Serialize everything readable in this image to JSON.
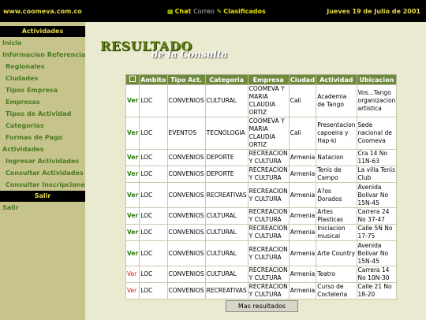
{
  "topbar": {
    "site": "www.coomeva.com.co",
    "chat": "Chat",
    "correo": "Correo",
    "clasificados": "Clasificados",
    "date": "Jueves 19 de Julio de 2001"
  },
  "sidebar": {
    "actividades_header": "Actividades",
    "items": [
      {
        "label": "Inicio",
        "level": 0
      },
      {
        "label": "Informacion Referencial",
        "level": 0
      },
      {
        "label": "Regionales",
        "level": 1
      },
      {
        "label": "Ciudades",
        "level": 1
      },
      {
        "label": "Tipos Empresa",
        "level": 1
      },
      {
        "label": "Empresas",
        "level": 1
      },
      {
        "label": "Tipos de Actividad",
        "level": 1
      },
      {
        "label": "Categorias",
        "level": 1
      },
      {
        "label": "Formas de Pago",
        "level": 1
      },
      {
        "label": "Actividades",
        "level": 0
      },
      {
        "label": "Ingresar Actividades",
        "level": 1
      },
      {
        "label": "Consultar Actividades",
        "level": 1
      },
      {
        "label": "Consultar Inscripciones",
        "level": 1
      }
    ],
    "salir_header": "Salir",
    "salir_item": "Salir"
  },
  "main": {
    "title1": "RESULTADO",
    "title2": "de la Consulta",
    "more_button": "Mas resultados"
  },
  "table": {
    "headers": [
      "Ambito",
      "Tipo Act.",
      "Categoria",
      "Empresa",
      "Ciudad",
      "Actividad",
      "Ubicacion"
    ],
    "ver_label": "Ver",
    "rows": [
      {
        "ambito": "LOC",
        "tipo": "CONVENIOS",
        "categoria": "CULTURAL",
        "empresa": "COOMEVA Y MARIA CLAUDIA ORTIZ",
        "ciudad": "Cali",
        "actividad": "Academia de Tango",
        "ubicacion": "Vos...Tango organizacion artistica",
        "red": false
      },
      {
        "ambito": "LOC",
        "tipo": "EVENTOS",
        "categoria": "TECNOLOGIA",
        "empresa": "COOMEVA Y MARIA CLAUDIA ORTIZ",
        "ciudad": "Cali",
        "actividad": "Presentacion capoeira y Hap-ki",
        "ubicacion": "Sede nacional de Coomeva",
        "red": false
      },
      {
        "ambito": "LOC",
        "tipo": "CONVENIOS",
        "categoria": "DEPORTE",
        "empresa": "RECREACION Y CULTURA",
        "ciudad": "Armenia",
        "actividad": "Natacion",
        "ubicacion": "Cra 14 No 11N-63",
        "red": false
      },
      {
        "ambito": "LOC",
        "tipo": "CONVENIOS",
        "categoria": "DEPORTE",
        "empresa": "RECREACION Y CULTURA",
        "ciudad": "Armenia",
        "actividad": "Tenis de Campo",
        "ubicacion": "La villa Tenis Club",
        "red": false
      },
      {
        "ambito": "LOC",
        "tipo": "CONVENIOS",
        "categoria": "RECREATIVAS",
        "empresa": "RECREACION Y CULTURA",
        "ciudad": "Armenia",
        "actividad": "A?os Dorados",
        "ubicacion": "Avenida Bolivar No 15N-45",
        "red": false
      },
      {
        "ambito": "LOC",
        "tipo": "CONVENIOS",
        "categoria": "CULTURAL",
        "empresa": "RECREACION Y CULTURA",
        "ciudad": "Armenia",
        "actividad": "Artes Plasticas",
        "ubicacion": "Carrera 24 No 37-47",
        "red": false
      },
      {
        "ambito": "LOC",
        "tipo": "CONVENIOS",
        "categoria": "CULTURAL",
        "empresa": "RECREACION Y CULTURA",
        "ciudad": "Armenia",
        "actividad": "Iniciacion musical",
        "ubicacion": "Calle 5N No 17-75",
        "red": false
      },
      {
        "ambito": "LOC",
        "tipo": "CONVENIOS",
        "categoria": "CULTURAL",
        "empresa": "RECREACION Y CULTURA",
        "ciudad": "Armenia",
        "actividad": "Arte Country",
        "ubicacion": "Avenida Bolivar No 15N-45",
        "red": false
      },
      {
        "ambito": "LOC",
        "tipo": "CONVENIOS",
        "categoria": "CULTURAL",
        "empresa": "RECREACION Y CULTURA",
        "ciudad": "Armenia",
        "actividad": "Teatro",
        "ubicacion": "Carrera 14 No 10N-30",
        "red": true
      },
      {
        "ambito": "LOC",
        "tipo": "CONVENIOS",
        "categoria": "RECREATIVAS",
        "empresa": "RECREACION Y CULTURA",
        "ciudad": "Armenia",
        "actividad": "Curso de Cocteleria",
        "ubicacion": "Calle 21 No 18-20",
        "red": true
      }
    ]
  }
}
